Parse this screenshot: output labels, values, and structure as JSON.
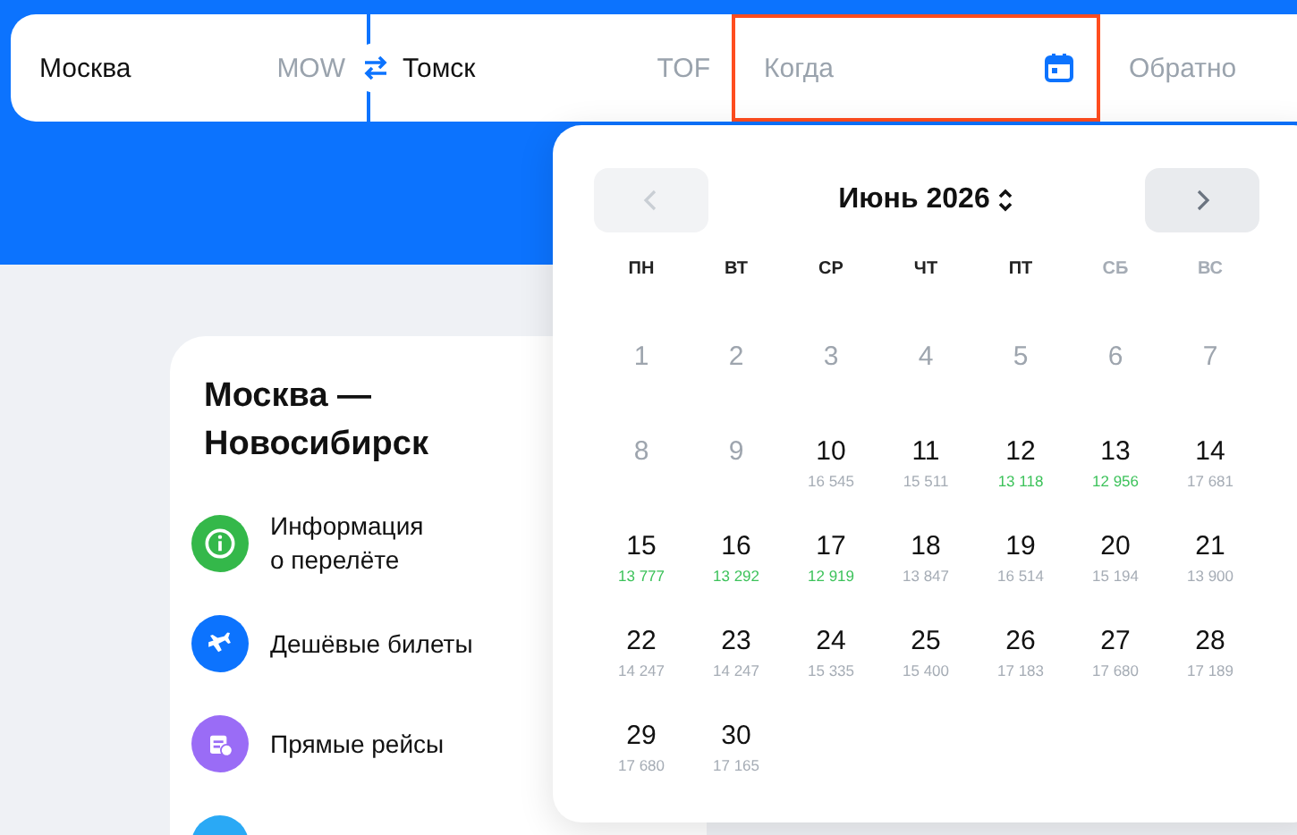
{
  "search": {
    "origin": {
      "city": "Москва",
      "code": "MOW"
    },
    "destination": {
      "city": "Томск",
      "code": "TOF"
    },
    "date": {
      "placeholder": "Когда",
      "focused": true
    },
    "return": {
      "placeholder": "Обратно"
    }
  },
  "route_card": {
    "title": "Москва —\nНовосибирск",
    "items": [
      {
        "kind": "info",
        "label": "Информация\nо перелёте"
      },
      {
        "kind": "plane",
        "label": "Дешёвые билеты"
      },
      {
        "kind": "schedule",
        "label": "Прямые рейсы"
      },
      {
        "kind": "more"
      }
    ]
  },
  "calendar": {
    "month": "Июнь 2026",
    "prev_disabled": true,
    "next_disabled": false,
    "weekdays": [
      {
        "label": "ПН",
        "weekend": false
      },
      {
        "label": "ВТ",
        "weekend": false
      },
      {
        "label": "СР",
        "weekend": false
      },
      {
        "label": "ЧТ",
        "weekend": false
      },
      {
        "label": "ПТ",
        "weekend": false
      },
      {
        "label": "СБ",
        "weekend": true
      },
      {
        "label": "ВС",
        "weekend": true
      }
    ],
    "days": [
      {
        "day": "1",
        "disabled": true
      },
      {
        "day": "2",
        "disabled": true
      },
      {
        "day": "3",
        "disabled": true
      },
      {
        "day": "4",
        "disabled": true
      },
      {
        "day": "5",
        "disabled": true
      },
      {
        "day": "6",
        "disabled": true
      },
      {
        "day": "7",
        "disabled": true
      },
      {
        "day": "8",
        "disabled": true
      },
      {
        "day": "9",
        "disabled": true
      },
      {
        "day": "10",
        "disabled": false,
        "price": "16 545",
        "cheap": false
      },
      {
        "day": "11",
        "disabled": false,
        "price": "15 511",
        "cheap": false
      },
      {
        "day": "12",
        "disabled": false,
        "price": "13 118",
        "cheap": true
      },
      {
        "day": "13",
        "disabled": false,
        "price": "12 956",
        "cheap": true
      },
      {
        "day": "14",
        "disabled": false,
        "price": "17 681",
        "cheap": false
      },
      {
        "day": "15",
        "disabled": false,
        "price": "13 777",
        "cheap": true
      },
      {
        "day": "16",
        "disabled": false,
        "price": "13 292",
        "cheap": true
      },
      {
        "day": "17",
        "disabled": false,
        "price": "12 919",
        "cheap": true
      },
      {
        "day": "18",
        "disabled": false,
        "price": "13 847",
        "cheap": false
      },
      {
        "day": "19",
        "disabled": false,
        "price": "16 514",
        "cheap": false
      },
      {
        "day": "20",
        "disabled": false,
        "price": "15 194",
        "cheap": false
      },
      {
        "day": "21",
        "disabled": false,
        "price": "13 900",
        "cheap": false
      },
      {
        "day": "22",
        "disabled": false,
        "price": "14 247",
        "cheap": false
      },
      {
        "day": "23",
        "disabled": false,
        "price": "14 247",
        "cheap": false
      },
      {
        "day": "24",
        "disabled": false,
        "price": "15 335",
        "cheap": false
      },
      {
        "day": "25",
        "disabled": false,
        "price": "15 400",
        "cheap": false
      },
      {
        "day": "26",
        "disabled": false,
        "price": "17 183",
        "cheap": false
      },
      {
        "day": "27",
        "disabled": false,
        "price": "17 680",
        "cheap": false
      },
      {
        "day": "28",
        "disabled": false,
        "price": "17 189",
        "cheap": false
      },
      {
        "day": "29",
        "disabled": false,
        "price": "17 680",
        "cheap": false
      },
      {
        "day": "30",
        "disabled": false,
        "price": "17 165",
        "cheap": false
      }
    ]
  }
}
